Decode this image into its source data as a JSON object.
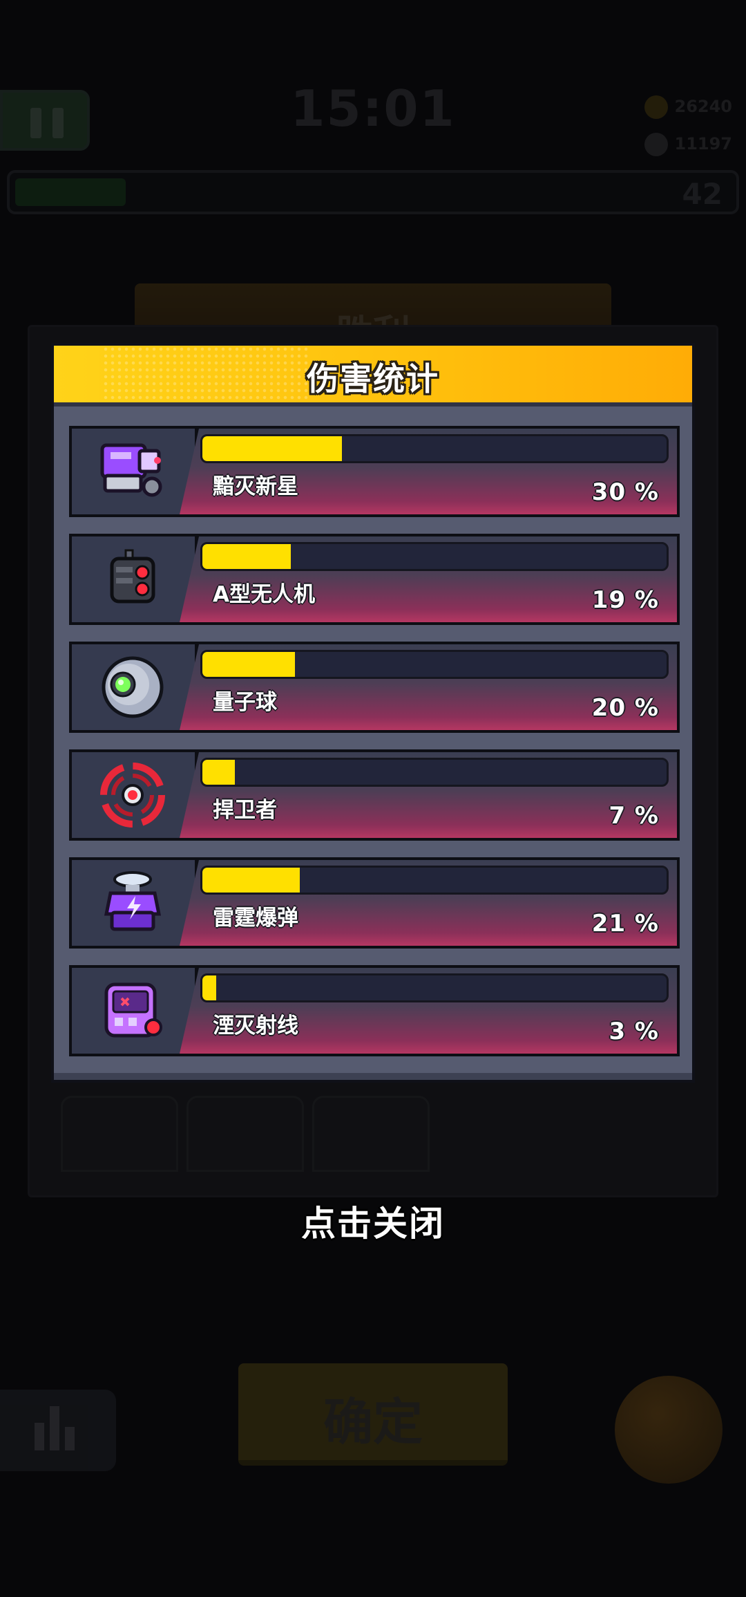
{
  "background": {
    "timer": "15:01",
    "coins": "26240",
    "kills": "11197",
    "level": "42",
    "victory_label": "胜利",
    "confirm_label": "确定"
  },
  "panel": {
    "title": "伤害统计",
    "weapons": [
      {
        "name": "黯灭新星",
        "percent_label": "30 %",
        "fraction": 0.3,
        "icon": "purple-cannon-icon"
      },
      {
        "name": "A型无人机",
        "percent_label": "19 %",
        "fraction": 0.19,
        "icon": "drone-icon"
      },
      {
        "name": "量子球",
        "percent_label": "20 %",
        "fraction": 0.2,
        "icon": "quantum-orb-icon"
      },
      {
        "name": "捍卫者",
        "percent_label": "7 %",
        "fraction": 0.07,
        "icon": "guardian-ring-icon"
      },
      {
        "name": "雷霆爆弹",
        "percent_label": "21 %",
        "fraction": 0.21,
        "icon": "thunder-bomb-icon"
      },
      {
        "name": "湮灭射线",
        "percent_label": "3 %",
        "fraction": 0.03,
        "icon": "annihilation-ray-icon"
      }
    ]
  },
  "close_hint": "点击关闭",
  "colors": {
    "header_yellow": "#ffc10d",
    "bar_fill": "#ffe000",
    "bar_gradient_pink": "#b53762",
    "panel_gray": "#565b70"
  }
}
